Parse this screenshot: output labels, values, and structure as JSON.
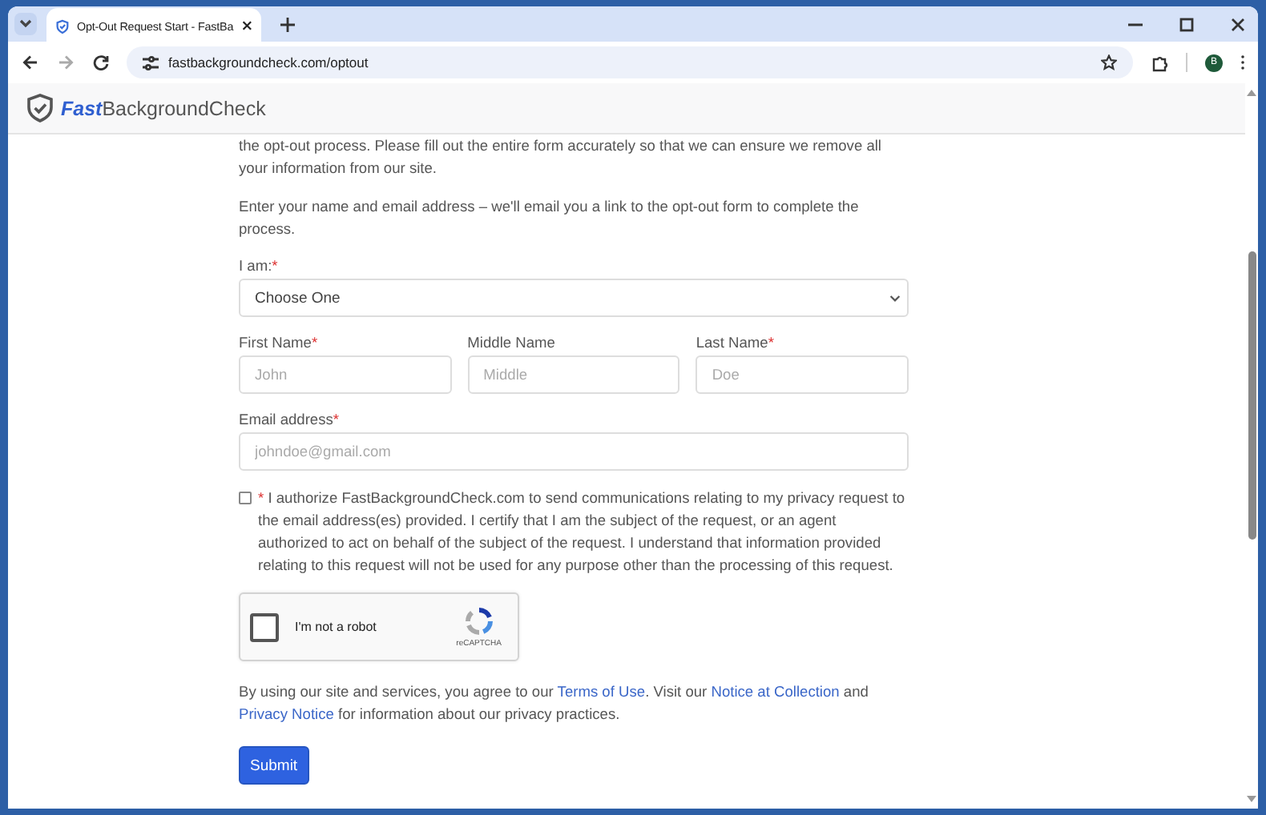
{
  "browser": {
    "tab": {
      "title": "Opt-Out Request Start - FastBa",
      "selected": true
    },
    "address": "fastbackgroundcheck.com/optout",
    "avatar": "B"
  },
  "site": {
    "logo_bold": "Fast",
    "logo_rest": "BackgroundCheck"
  },
  "intro": [
    "the opt-out process. Please fill out the entire form accurately so that we can ensure we remove all your information from our site.",
    "Enter your name and email address – we'll email you a link to the opt-out form to complete the process."
  ],
  "select": {
    "label": "I am:",
    "required_mark": "*",
    "value": "Choose One"
  },
  "name_fields": [
    {
      "label": "First Name",
      "required_mark": "*",
      "placeholder": "John"
    },
    {
      "label": "Middle Name",
      "placeholder": "Middle"
    },
    {
      "label": "Last Name",
      "required_mark": "*",
      "placeholder": "Doe"
    }
  ],
  "email": {
    "label": "Email address",
    "required_mark": "*",
    "placeholder": "johndoe@gmail.com"
  },
  "consent": {
    "checked": false,
    "required_mark": "*",
    "text": "I authorize FastBackgroundCheck.com to send communications relating to my privacy request to the email address(es) provided. I certify that I am the subject of the request, or an agent authorized to act on behalf of the subject of the request. I understand that information provided relating to this request will not be used for any purpose other than the processing of this request."
  },
  "captcha": {
    "checked": false,
    "label": "I'm not a robot",
    "brand": "reCAPTCHA"
  },
  "legal": [
    {
      "kind": "text",
      "text": "By using our site and services, you agree to our "
    },
    {
      "kind": "link",
      "text": "Terms of Use"
    },
    {
      "kind": "text",
      "text": ". Visit our "
    },
    {
      "kind": "link",
      "text": "Notice at Collection"
    },
    {
      "kind": "text",
      "text": " and "
    },
    {
      "kind": "link",
      "text": "Privacy Notice"
    },
    {
      "kind": "text",
      "text": " for information about our privacy practices."
    }
  ],
  "submit": "Submit"
}
